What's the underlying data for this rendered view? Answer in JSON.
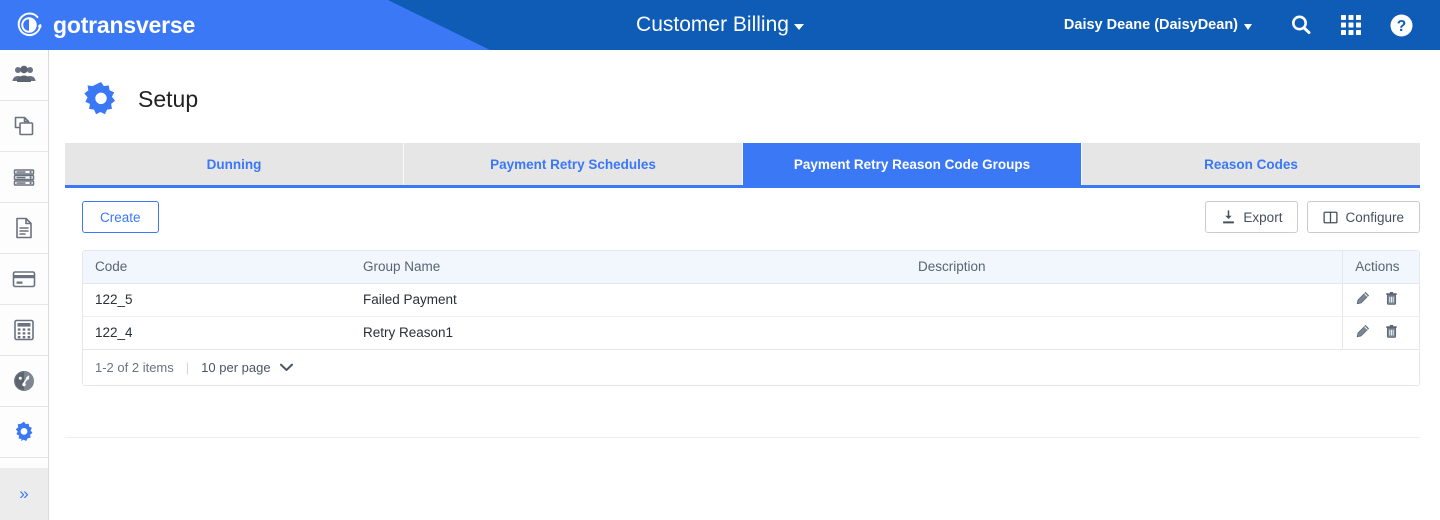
{
  "brand": {
    "name": "gotransverse",
    "logo_icon": "gotransverse-logo-icon"
  },
  "header": {
    "app_title": "Customer Billing",
    "user_label": "Daisy Deane (DaisyDean)",
    "icons": {
      "search": "search-icon",
      "apps": "apps-grid-icon",
      "help": "help-circle-icon"
    }
  },
  "sidebar": {
    "items": [
      {
        "name": "customers",
        "icon": "people-group-icon"
      },
      {
        "name": "products",
        "icon": "copy-documents-icon"
      },
      {
        "name": "catalog",
        "icon": "server-stack-icon"
      },
      {
        "name": "invoices",
        "icon": "document-icon"
      },
      {
        "name": "payments",
        "icon": "credit-card-icon"
      },
      {
        "name": "accounting",
        "icon": "calculator-icon"
      },
      {
        "name": "reports",
        "icon": "dashboard-gauge-icon"
      },
      {
        "name": "setup",
        "icon": "gear-icon",
        "active": true
      }
    ],
    "expand_label": "»"
  },
  "page": {
    "title": "Setup",
    "title_icon": "gear-icon"
  },
  "tabs": [
    {
      "label": "Dunning",
      "active": false
    },
    {
      "label": "Payment Retry Schedules",
      "active": false
    },
    {
      "label": "Payment Retry Reason Code Groups",
      "active": true
    },
    {
      "label": "Reason Codes",
      "active": false
    }
  ],
  "toolbar": {
    "create_label": "Create",
    "export_label": "Export",
    "configure_label": "Configure",
    "export_icon": "download-icon",
    "configure_icon": "columns-icon"
  },
  "table": {
    "columns": [
      "Code",
      "Group Name",
      "Description",
      "Actions"
    ],
    "rows": [
      {
        "code": "122_5",
        "group_name": "Failed Payment",
        "description": ""
      },
      {
        "code": "122_4",
        "group_name": "Retry Reason1",
        "description": ""
      }
    ],
    "row_actions": {
      "edit_icon": "pencil-edit-icon",
      "delete_icon": "trash-delete-icon"
    }
  },
  "pagination": {
    "summary": "1-2 of 2 items",
    "separator": "|",
    "page_size_label": "10 per page",
    "chevron_icon": "chevron-down-icon"
  },
  "colors": {
    "brand_blue": "#3b78f6",
    "header_dark_blue": "#0e5cb5",
    "tab_inactive_bg": "#e6e6e6",
    "table_header_bg": "#f2f6fd",
    "border": "#e4e7ec"
  }
}
